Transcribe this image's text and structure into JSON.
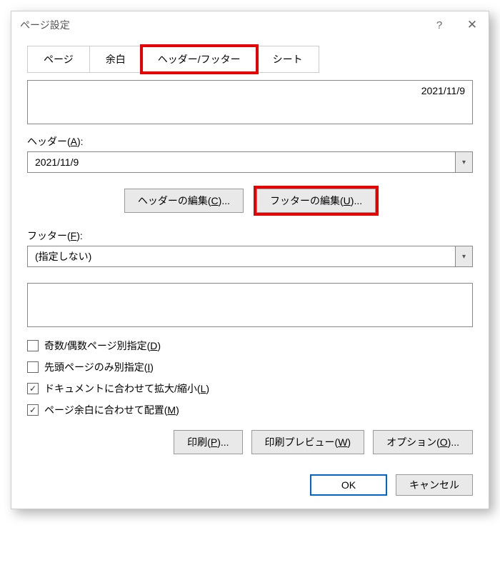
{
  "titlebar": {
    "title": "ページ設定",
    "help": "?",
    "close": "✕"
  },
  "tabs": {
    "page": "ページ",
    "margins": "余白",
    "headerfooter": "ヘッダー/フッター",
    "sheet": "シート"
  },
  "panel": {
    "header_preview": "2021/11/9",
    "header_label_pre": "ヘッダー(",
    "header_label_key": "A",
    "header_label_post": "):",
    "header_value": "2021/11/9",
    "edit_header_pre": "ヘッダーの編集(",
    "edit_header_key": "C",
    "edit_header_post": ")...",
    "edit_footer_pre": "フッターの編集(",
    "edit_footer_key": "U",
    "edit_footer_post": ")...",
    "footer_label_pre": "フッター(",
    "footer_label_key": "F",
    "footer_label_post": "):",
    "footer_value": "(指定しない)",
    "chk_oddpages_pre": "奇数/偶数ページ別指定(",
    "chk_oddpages_key": "D",
    "chk_oddpages_post": ")",
    "chk_firstpage_pre": "先頭ページのみ別指定(",
    "chk_firstpage_key": "I",
    "chk_firstpage_post": ")",
    "chk_scale_pre": "ドキュメントに合わせて拡大/縮小(",
    "chk_scale_key": "L",
    "chk_scale_post": ")",
    "chk_align_pre": "ページ余白に合わせて配置(",
    "chk_align_key": "M",
    "chk_align_post": ")",
    "print_pre": "印刷(",
    "print_key": "P",
    "print_post": ")...",
    "preview_pre": "印刷プレビュー(",
    "preview_key": "W",
    "preview_post": ")",
    "options_pre": "オプション(",
    "options_key": "O",
    "options_post": ")..."
  },
  "dialog": {
    "ok": "OK",
    "cancel": "キャンセル"
  },
  "glyphs": {
    "checkmark": "✓",
    "dropdown": "▾"
  }
}
